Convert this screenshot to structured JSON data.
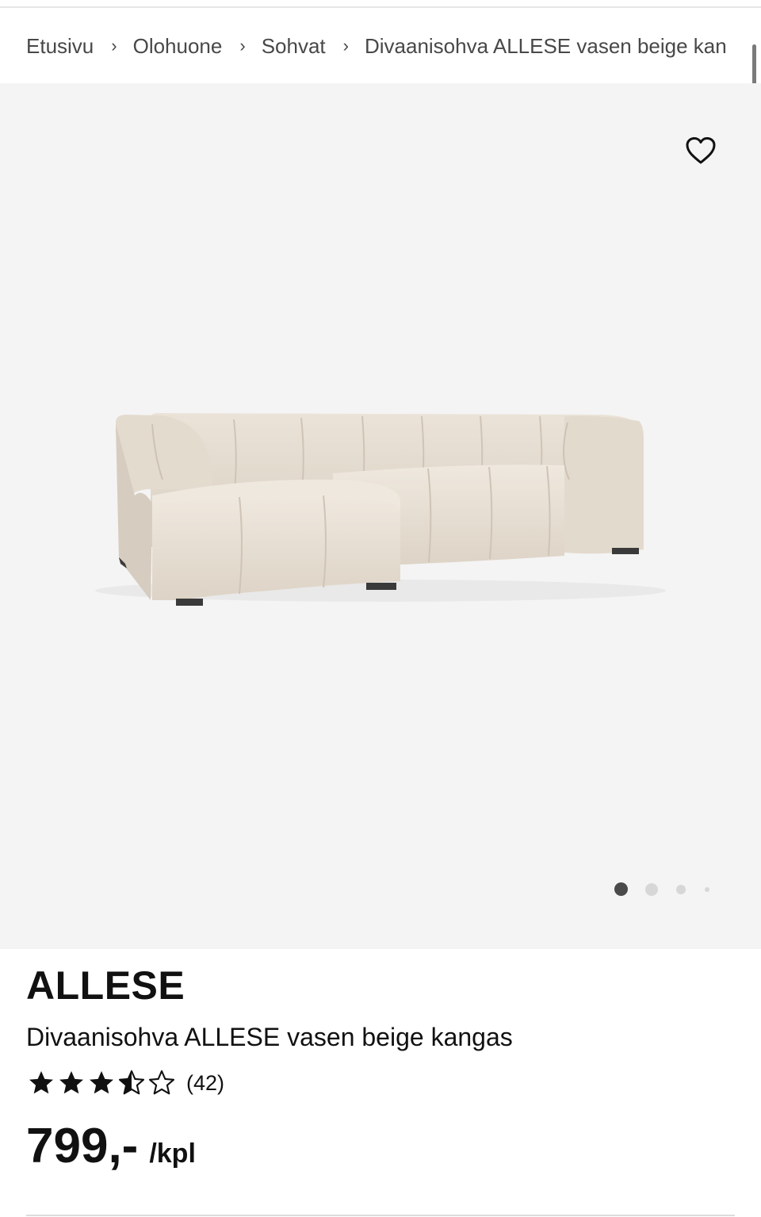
{
  "breadcrumb": {
    "items": [
      {
        "label": "Etusivu"
      },
      {
        "label": "Olohuone"
      },
      {
        "label": "Sohvat"
      },
      {
        "label": "Divaanisohva ALLESE vasen beige kan"
      }
    ],
    "separator": "›"
  },
  "gallery": {
    "favorite_icon": "heart-outline-icon",
    "image_count": 4,
    "active_index": 0,
    "background_color": "#f4f4f4",
    "sofa_color": "#e6ddd1"
  },
  "product": {
    "brand": "ALLESE",
    "description": "Divaanisohva ALLESE vasen beige kangas",
    "rating": {
      "value": 3.5,
      "max": 5,
      "count_label": "(42)"
    },
    "price": {
      "value": "799,-",
      "unit": "/kpl"
    }
  }
}
